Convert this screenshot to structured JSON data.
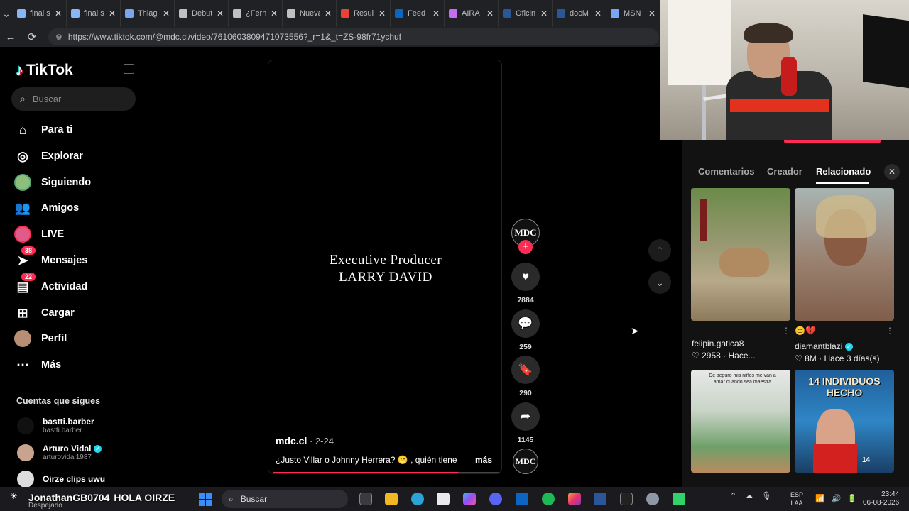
{
  "browser": {
    "tabs": [
      {
        "label": "final s",
        "color": "#8ab4f8"
      },
      {
        "label": "final s",
        "color": "#8ab4f8"
      },
      {
        "label": "Thiago",
        "color": "#7aa5f5"
      },
      {
        "label": "Debut",
        "color": "#c0c0c0"
      },
      {
        "label": "¿Ferna",
        "color": "#c0c0c0"
      },
      {
        "label": "Nueva",
        "color": "#c0c0c0"
      },
      {
        "label": "Result",
        "color": "#ea4335"
      },
      {
        "label": "Feed",
        "color": "#0a66c2"
      },
      {
        "label": "AIRA",
        "color": "#c56cf0"
      },
      {
        "label": "Oficin",
        "color": "#2b5797"
      },
      {
        "label": "docM",
        "color": "#2b5797"
      },
      {
        "label": "MSN",
        "color": "#7aa5f5"
      }
    ],
    "url": "https://www.tiktok.com/@mdc.cl/video/7610603809471073556?_r=1&_t=ZS-98fr71ychuf"
  },
  "sidebar": {
    "logo": "TikTok",
    "search_placeholder": "Buscar",
    "nav": [
      {
        "label": "Para ti",
        "icon": "home-icon"
      },
      {
        "label": "Explorar",
        "icon": "compass-icon"
      },
      {
        "label": "Siguiendo",
        "icon": "following-avatar-icon"
      },
      {
        "label": "Amigos",
        "icon": "friends-icon"
      },
      {
        "label": "LIVE",
        "icon": "live-icon"
      },
      {
        "label": "Mensajes",
        "icon": "messages-icon",
        "badge": "38"
      },
      {
        "label": "Actividad",
        "icon": "activity-icon",
        "badge": "22"
      },
      {
        "label": "Cargar",
        "icon": "upload-icon"
      },
      {
        "label": "Perfil",
        "icon": "profile-avatar-icon"
      },
      {
        "label": "Más",
        "icon": "more-icon"
      }
    ],
    "following_heading": "Cuentas que sigues",
    "following": [
      {
        "name": "bastti.barber",
        "handle": "bastti.barber"
      },
      {
        "name": "Arturo Vidal",
        "handle": "arturovidal1987",
        "verified": true
      },
      {
        "name": "Oirze clips uwu",
        "handle": ""
      }
    ]
  },
  "video": {
    "credit_line1": "Executive Producer",
    "credit_line2": "LARRY DAVID",
    "author": "mdc.cl",
    "date": " · 2-24",
    "caption": "¿Justo Villar o Johnny Herrera? 😬 , quién tiene",
    "more": "más",
    "progress": 0.82
  },
  "actions": {
    "creator_initials": "MDC",
    "likes": "7884",
    "comments": "259",
    "saves": "290",
    "shares": "1145"
  },
  "panel": {
    "tabs": [
      "Comentarios",
      "Creador",
      "Relacionado"
    ],
    "active_tab": "Relacionado",
    "cards": [
      {
        "user": "felipin.gatica8",
        "likes": "2958",
        "when": "Hace...",
        "emoji": ""
      },
      {
        "user": "diamantblazi",
        "likes": "8M",
        "when": "Hace 3 días(s)",
        "emoji": "😊💔",
        "verified": true
      },
      {
        "overlay": "De seguro mis niños me van a amar cuando sea maestra"
      },
      {
        "overlay": "14 INDIVIDUOS HECHO",
        "tag": "14"
      }
    ]
  },
  "taskbar": {
    "weather_temp": "☀",
    "weather_label": "Despejado",
    "stream_overlay": "JonathanGB0704",
    "stream_greeting": "HOLA OIRZE",
    "search_placeholder": "Buscar",
    "lang1": "ESP",
    "lang2": "LAA",
    "time": "23:44",
    "date": "06-08-2026"
  }
}
